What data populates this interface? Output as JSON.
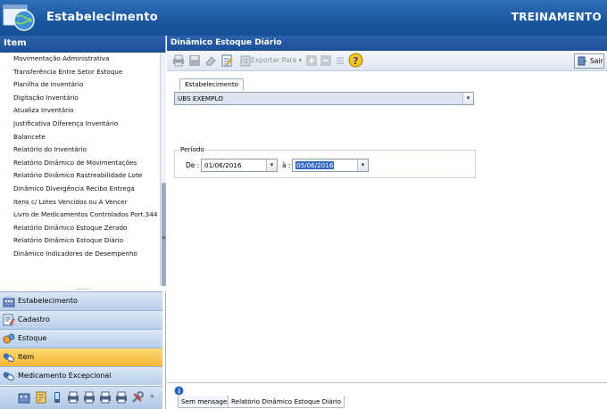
{
  "header": {
    "title": "Estabelecimento",
    "environment": "TREINAMENTO",
    "icon": "globe-window-icon"
  },
  "left_panel": {
    "title": "Item",
    "items": [
      "Movimentação Administrativa",
      "Transferência Entre Setor Estoque",
      "Planilha de Inventário",
      "Digitação Inventário",
      "Atualiza Inventário",
      "Justificativa Diferença Inventário",
      "Balancete",
      "Relatório do Inventário",
      "Relatório Dinâmico de Movimentações",
      "Relatório Dinâmico Rastreabilidade Lote",
      "Dinâmico Divergência Recibo Entrega",
      "Itens c/ Lotes Vencidos ou A Vencer",
      "Livro de Medicamentos Controlados Port.344",
      "Relatório Dinâmico Estoque Zerado",
      "Relatório Dinâmico Estoque Diário",
      "Dinâmico Indicadores de Desempenho"
    ],
    "splitter": "........",
    "collapse_glyph": "«",
    "nav": [
      {
        "label": "Estabelecimento",
        "icon": "building-icon",
        "active": false
      },
      {
        "label": "Cadastro",
        "icon": "edit-form-icon",
        "active": false
      },
      {
        "label": "Estoque",
        "icon": "stock-icon",
        "active": false
      },
      {
        "label": "Item",
        "icon": "pill-icon",
        "active": true
      },
      {
        "label": "Medicamento Excepcional",
        "icon": "pill-icon",
        "active": false
      }
    ],
    "overflow_glyph": "»"
  },
  "right_panel": {
    "title": "Dinâmico Estoque Diário",
    "toolbar": {
      "exportar_label": "Exportar Para",
      "exportar_arrow": "▾",
      "sair_label": "Sair"
    },
    "tab_label": "Estabelecimento",
    "estabelecimento_value": "UBS EXEMPLO",
    "periodo_label": "Período",
    "de_label": "De :",
    "de_value": "01/06/2016",
    "a_label": "à :",
    "a_value": "05/06/2016",
    "dropdown_glyph": "▾"
  },
  "status": {
    "tab1": "Sem mensagem",
    "tab2": "Relatório Dinâmico Estoque Diário"
  },
  "colors": {
    "header_blue": "#1a579f",
    "active_nav": "#f5b631",
    "selection": "#3369c4"
  }
}
